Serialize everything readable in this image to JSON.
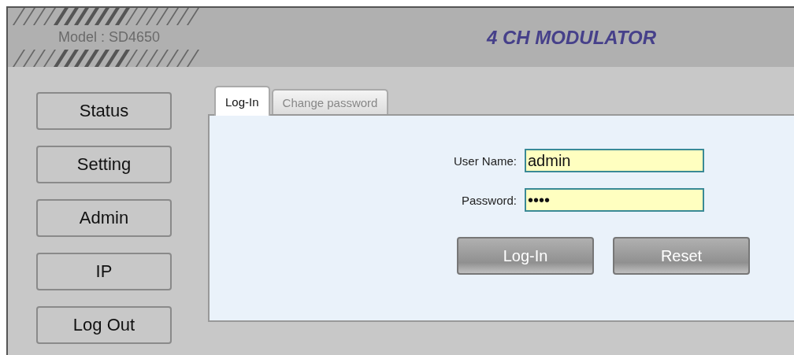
{
  "header": {
    "model": "Model : SD4650",
    "title": "4 CH MODULATOR"
  },
  "sidebar": {
    "items": [
      {
        "label": "Status"
      },
      {
        "label": "Setting"
      },
      {
        "label": "Admin"
      },
      {
        "label": "IP"
      },
      {
        "label": "Log Out"
      }
    ]
  },
  "tabs": [
    {
      "label": "Log-In",
      "selected": true
    },
    {
      "label": "Change password",
      "selected": false
    }
  ],
  "form": {
    "fields": [
      {
        "label": "User Name:",
        "value": "admin"
      },
      {
        "label": "Password:",
        "value": "••••"
      }
    ],
    "buttons": [
      "Log-In",
      "Reset"
    ]
  }
}
